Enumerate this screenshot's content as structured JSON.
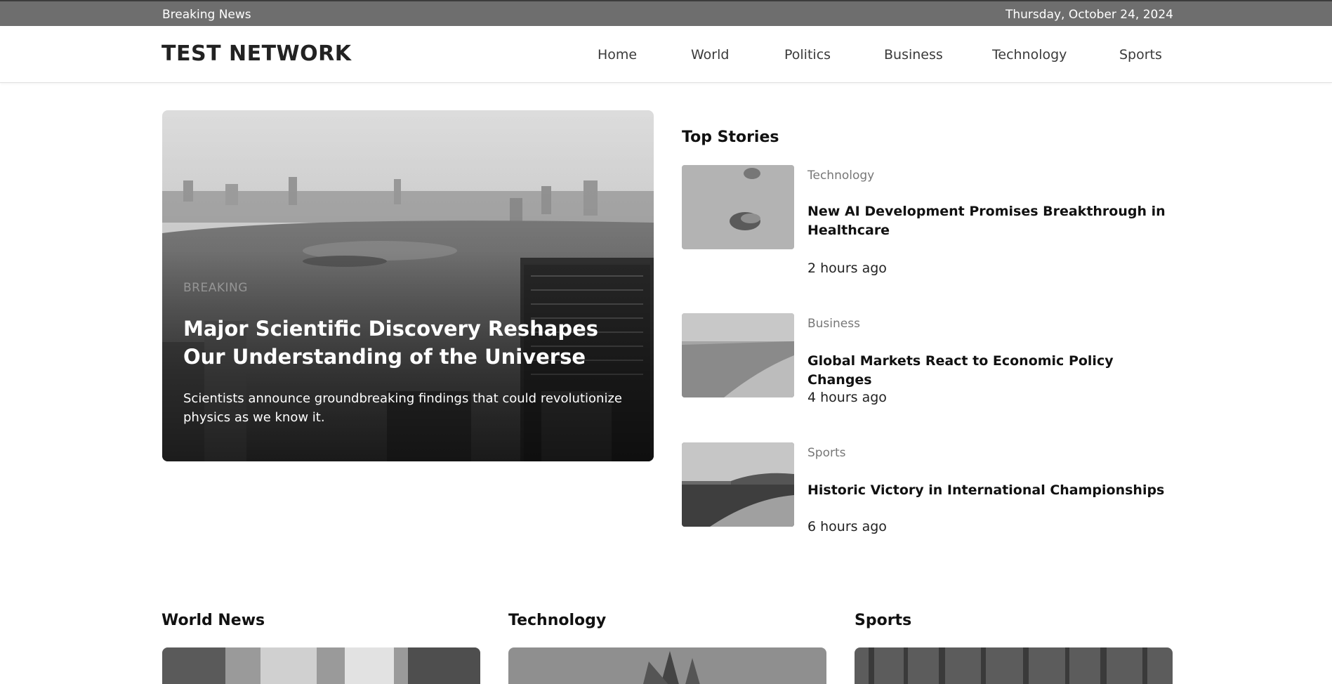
{
  "topbar": {
    "label": "Breaking News",
    "date": "Thursday, October 24, 2024"
  },
  "brand": {
    "name": "TEST NETWORK"
  },
  "nav": [
    "Home",
    "World",
    "Politics",
    "Business",
    "Technology",
    "Sports"
  ],
  "hero": {
    "tag": "BREAKING",
    "title": "Major Scientific Discovery Reshapes Our Understanding of the Universe",
    "summary": "Scientists announce groundbreaking findings that could revolutionize physics as we know it."
  },
  "top_stories": {
    "heading": "Top Stories",
    "items": [
      {
        "category": "Technology",
        "title": "New AI Development Promises Breakthrough in Healthcare",
        "time": "2 hours ago"
      },
      {
        "category": "Business",
        "title": "Global Markets React to Economic Policy Changes",
        "time": "4 hours ago"
      },
      {
        "category": "Sports",
        "title": "Historic Victory in International Championships",
        "time": "6 hours ago"
      }
    ]
  },
  "sections": [
    {
      "heading": "World News"
    },
    {
      "heading": "Technology"
    },
    {
      "heading": "Sports"
    }
  ],
  "colors": {
    "topbar": "#6e6e6e",
    "text": "#111111",
    "muted": "#777777"
  }
}
